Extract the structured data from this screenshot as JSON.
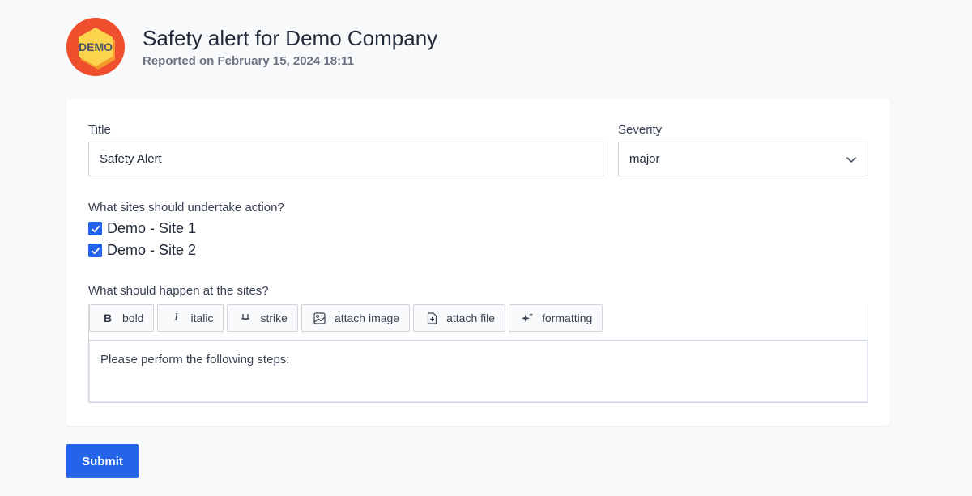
{
  "header": {
    "logo_text": "DEMO",
    "title": "Safety alert for Demo Company",
    "subtitle": "Reported on February 15, 2024 18:11"
  },
  "form": {
    "title_label": "Title",
    "title_value": "Safety Alert",
    "severity_label": "Severity",
    "severity_value": "major",
    "sites_label": "What sites should undertake action?",
    "sites": [
      {
        "label": "Demo - Site 1",
        "checked": true
      },
      {
        "label": "Demo - Site 2",
        "checked": true
      }
    ],
    "action_label": "What should happen at the sites?",
    "toolbar": [
      {
        "icon": "bold-icon",
        "label": "bold"
      },
      {
        "icon": "italic-icon",
        "label": "italic"
      },
      {
        "icon": "strike-icon",
        "label": "strike"
      },
      {
        "icon": "image-icon",
        "label": "attach image"
      },
      {
        "icon": "file-icon",
        "label": "attach file"
      },
      {
        "icon": "sparkle-icon",
        "label": "formatting"
      }
    ],
    "editor_text": "Please perform the following steps:"
  },
  "submit_label": "Submit",
  "colors": {
    "accent": "#2563eb",
    "logo_bg": "#f0512f",
    "logo_hex": "#fcd34d",
    "page_bg": "#f8f9fb"
  }
}
